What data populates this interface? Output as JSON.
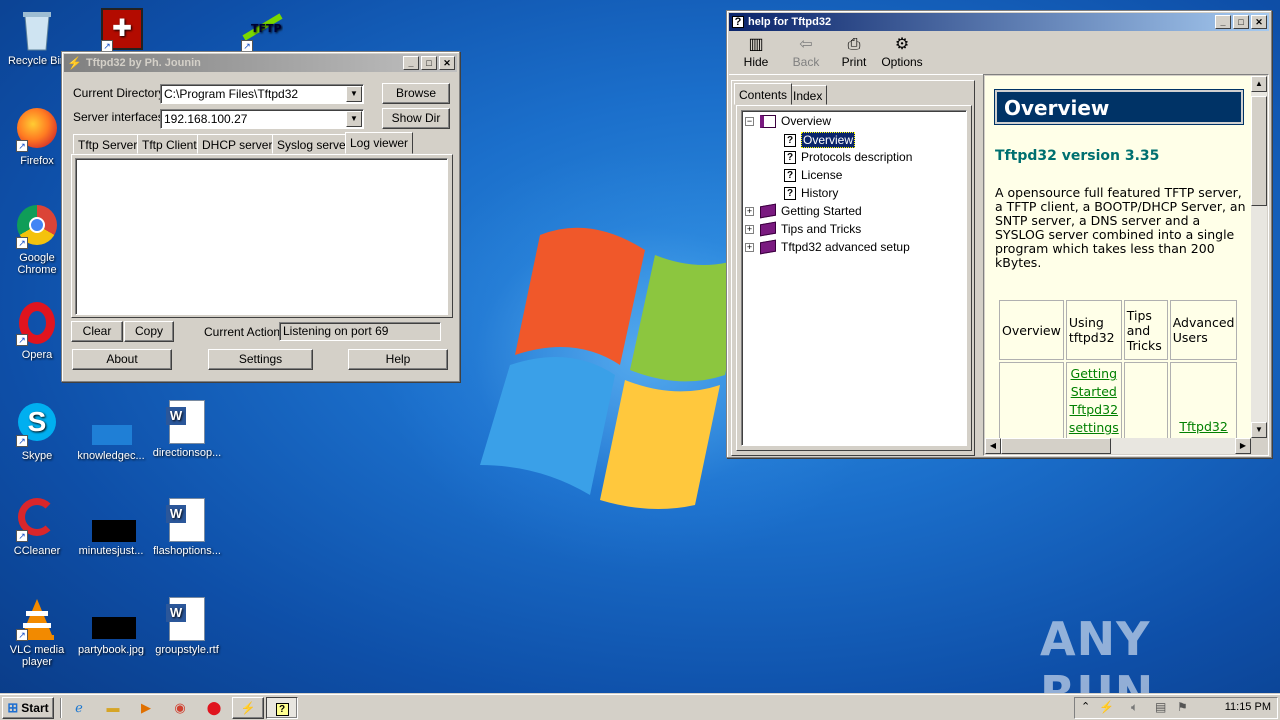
{
  "desktop": {
    "icons": [
      {
        "label": "Recycle Bin"
      },
      {
        "label": "Firefox"
      },
      {
        "label": "Google Chrome"
      },
      {
        "label": "Opera"
      },
      {
        "label": "Skype"
      },
      {
        "label": "CCleaner"
      },
      {
        "label": "VLC media player"
      },
      {
        "label": "knowledgec..."
      },
      {
        "label": "directionsop..."
      },
      {
        "label": "minutesjust..."
      },
      {
        "label": "flashoptions..."
      },
      {
        "label": "partybook.jpg"
      },
      {
        "label": "groupstyle.rtf"
      }
    ],
    "watermark": "ANY RUN"
  },
  "tftpd": {
    "title": "Tftpd32 by Ph. Jounin",
    "current_directory_label": "Current Directory",
    "current_directory_value": "C:\\Program Files\\Tftpd32",
    "server_interfaces_label": "Server interfaces",
    "server_interfaces_value": "192.168.100.27",
    "browse": "Browse",
    "show_dir": "Show Dir",
    "tabs": [
      "Tftp Server",
      "Tftp Client",
      "DHCP server",
      "Syslog server",
      "Log viewer"
    ],
    "selected_tab": "Log viewer",
    "clear": "Clear",
    "copy": "Copy",
    "current_action_label": "Current Action",
    "current_action_value": "Listening on port 69",
    "about": "About",
    "settings": "Settings",
    "help": "Help"
  },
  "help": {
    "title": "help for Tftpd32",
    "toolbar": {
      "hide": "Hide",
      "back": "Back",
      "print": "Print",
      "options": "Options"
    },
    "tabs": {
      "contents": "Contents",
      "index": "Index"
    },
    "tree": {
      "overview": "Overview",
      "children": [
        "Overview",
        "Protocols description",
        "License",
        "History"
      ],
      "books": [
        "Getting Started",
        "Tips and Tricks",
        "Tftpd32 advanced setup"
      ]
    },
    "content": {
      "heading": "Overview",
      "version": "Tftpd32 version 3.35",
      "description": "A opensource full featured TFTP server, a TFTP client, a BOOTP/DHCP Server, an SNTP server, a DNS server and a SYSLOG server combined into a single program which takes less than 200 kBytes.",
      "table_headers": [
        "Overview",
        "Using tftpd32",
        "Tips and Tricks",
        "Advanced Users"
      ],
      "links": [
        "Getting Started",
        "Tftpd32 settings",
        "Tftpd32"
      ]
    }
  },
  "taskbar": {
    "start": "Start",
    "clock": "11:15 PM"
  }
}
